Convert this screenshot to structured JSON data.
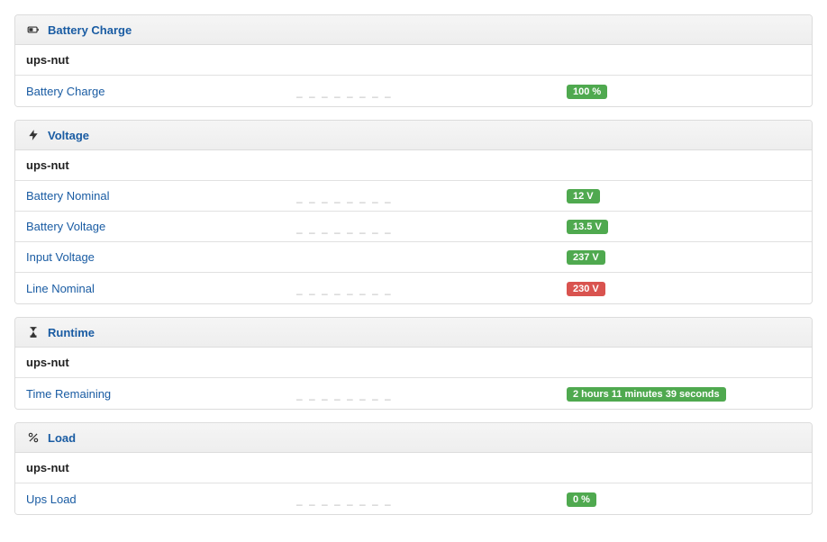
{
  "dashes": "– – – – – – – –",
  "panels": [
    {
      "icon": "battery",
      "title": "Battery Charge",
      "device": "ups-nut",
      "rows": [
        {
          "label": "Battery Charge",
          "value": "100 %",
          "status": "green",
          "graph": true
        }
      ]
    },
    {
      "icon": "bolt",
      "title": "Voltage",
      "device": "ups-nut",
      "rows": [
        {
          "label": "Battery Nominal",
          "value": "12 V",
          "status": "green",
          "graph": true
        },
        {
          "label": "Battery Voltage",
          "value": "13.5 V",
          "status": "green",
          "graph": true
        },
        {
          "label": "Input Voltage",
          "value": "237 V",
          "status": "green",
          "graph": false
        },
        {
          "label": "Line Nominal",
          "value": "230 V",
          "status": "red",
          "graph": true
        }
      ]
    },
    {
      "icon": "hourglass",
      "title": "Runtime",
      "device": "ups-nut",
      "rows": [
        {
          "label": "Time Remaining",
          "value": "2 hours 11 minutes 39 seconds",
          "status": "green",
          "graph": true
        }
      ]
    },
    {
      "icon": "percent",
      "title": "Load",
      "device": "ups-nut",
      "rows": [
        {
          "label": "Ups Load",
          "value": "0 %",
          "status": "green",
          "graph": true
        }
      ]
    }
  ]
}
